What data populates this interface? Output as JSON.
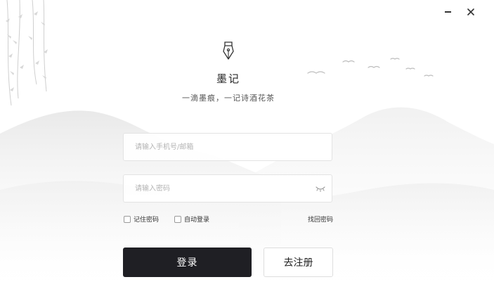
{
  "window": {
    "minimize_glyph": "−",
    "close_glyph": "✕"
  },
  "app": {
    "title": "墨记",
    "slogan": "一滴墨痕，一记诗酒花茶",
    "logo_icon": "fountain-pen-nib-icon"
  },
  "form": {
    "account_placeholder": "请输入手机号/邮箱",
    "account_value": "",
    "password_placeholder": "请输入密码",
    "password_value": "",
    "password_toggle_icon": "eye-closed-icon",
    "remember_label": "记住密码",
    "remember_checked": false,
    "auto_login_label": "自动登录",
    "auto_login_checked": false,
    "forgot_label": "找回密码",
    "login_label": "登录",
    "register_label": "去注册"
  },
  "colors": {
    "login_button": "#1f1f24",
    "ink_wash": "#e8e8e8"
  }
}
